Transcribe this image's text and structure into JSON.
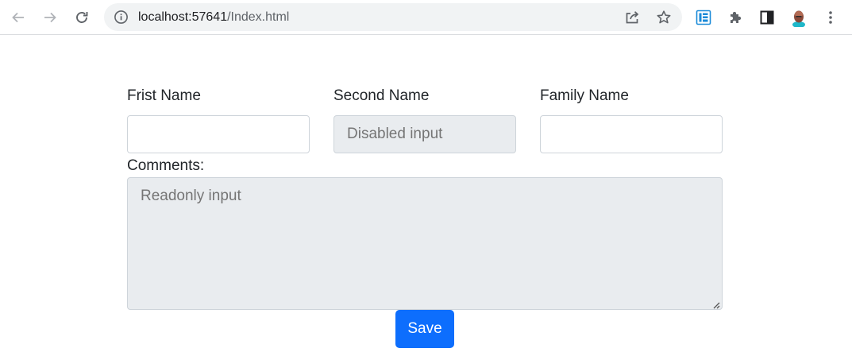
{
  "browser": {
    "url_host": "localhost:57641",
    "url_path": "/Index.html"
  },
  "form": {
    "first_name_label": "Frist Name",
    "first_name_value": "",
    "second_name_label": "Second Name",
    "second_name_placeholder": "Disabled input",
    "family_name_label": "Family Name",
    "family_name_value": "",
    "comments_label": "Comments:",
    "comments_placeholder": "Readonly input",
    "save_label": "Save"
  },
  "colors": {
    "primary": "#0d6efd",
    "disabled_bg": "#e9ecef",
    "border": "#ced4da"
  }
}
